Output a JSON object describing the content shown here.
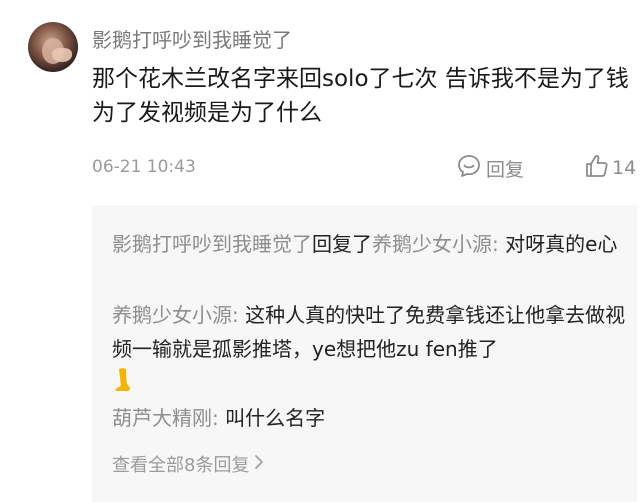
{
  "comment": {
    "username": "影鹅打呼吵到我睡觉了",
    "text": "那个花木兰改名字来回solo了七次 告诉我不是为了钱为了发视频是为了什么",
    "time": "06-21 10:43",
    "reply_label": "回复",
    "like_count": "14"
  },
  "replies": [
    {
      "author": "影鹅打呼吵到我睡觉了",
      "connector": "回复了",
      "target": "养鹅少女小源:",
      "text": " 对呀真的e心"
    },
    {
      "author": "养鹅少女小源:",
      "text": " 这种人真的快吐了免费拿钱还让他拿去做视频一输就是孤影推塔，ye想把他zu fen推了"
    },
    {
      "author": "葫芦大精刚:",
      "text": " 叫什么名字"
    }
  ],
  "view_all_label": "查看全部8条回复",
  "colors": {
    "name_gray": "#8e8e8e",
    "text": "#1a1a1a",
    "reply_bg": "#f7f7f7",
    "emoji_leg": "#f5b400"
  },
  "icons": {
    "reply": "speech-bubble-icon",
    "like": "thumbs-up-icon",
    "arrow": "chevron-right-icon",
    "emoji": "leg-emoji"
  }
}
